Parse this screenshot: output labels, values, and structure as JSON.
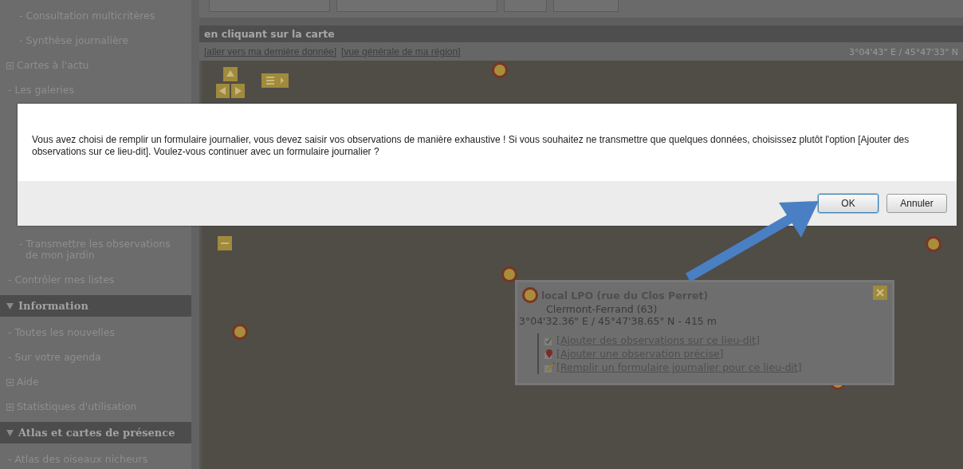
{
  "sidebar": {
    "items": [
      {
        "kind": "subitem",
        "label": "- Consultation multicritères"
      },
      {
        "kind": "subitem",
        "label": "- Synthèse journalière"
      },
      {
        "kind": "expandable",
        "label": "Cartes à l'actu"
      },
      {
        "kind": "item",
        "label": "- Les galeries"
      },
      {
        "kind": "gap"
      },
      {
        "kind": "subitem",
        "label": "- Transmettre les observations de mon jardin"
      },
      {
        "kind": "item",
        "label": "- Contrôler mes listes"
      },
      {
        "kind": "header",
        "label": "Information"
      },
      {
        "kind": "item",
        "label": "- Toutes les nouvelles"
      },
      {
        "kind": "item",
        "label": "- Sur votre agenda"
      },
      {
        "kind": "expandable",
        "label": "Aide"
      },
      {
        "kind": "expandable",
        "label": "Statistiques d'utilisation"
      },
      {
        "kind": "header",
        "label": "Atlas et cartes de présence"
      },
      {
        "kind": "item",
        "label": "- Atlas des oiseaux nicheurs"
      }
    ]
  },
  "map_panel": {
    "header": "en cliquant sur la carte",
    "links": [
      "[aller vers ma dernière donnée]",
      "[vue générale de ma région]"
    ],
    "coordinates": "3°04'43\" E / 45°47'33\" N",
    "popup": {
      "title": "local LPO (rue du Clos Perret)",
      "subtitle": "Clermont-Ferrand (63)",
      "position": "3°04'32.36\" E / 45°47'38.65\" N - 415 m",
      "actions": [
        {
          "kind": "list",
          "label": "[Ajouter des observations sur ce lieu-dit]"
        },
        {
          "kind": "precise",
          "label": "[Ajouter une observation précise]"
        },
        {
          "kind": "daily",
          "label": "[Remplir un formulaire journalier pour ce lieu-dit]"
        }
      ]
    }
  },
  "dialog": {
    "message": "Vous avez choisi de remplir un formulaire journalier, vous devez saisir vos observations de manière exhaustive ! Si vous souhaitez ne transmettre que quelques données, choisissez plutôt l'option [Ajouter des observations sur ce lieu-dit]. Voulez-vous continuer avec un formulaire journalier ?",
    "buttons": [
      {
        "label": "OK",
        "selected": true
      },
      {
        "label": "Annuler",
        "selected": false
      }
    ]
  }
}
